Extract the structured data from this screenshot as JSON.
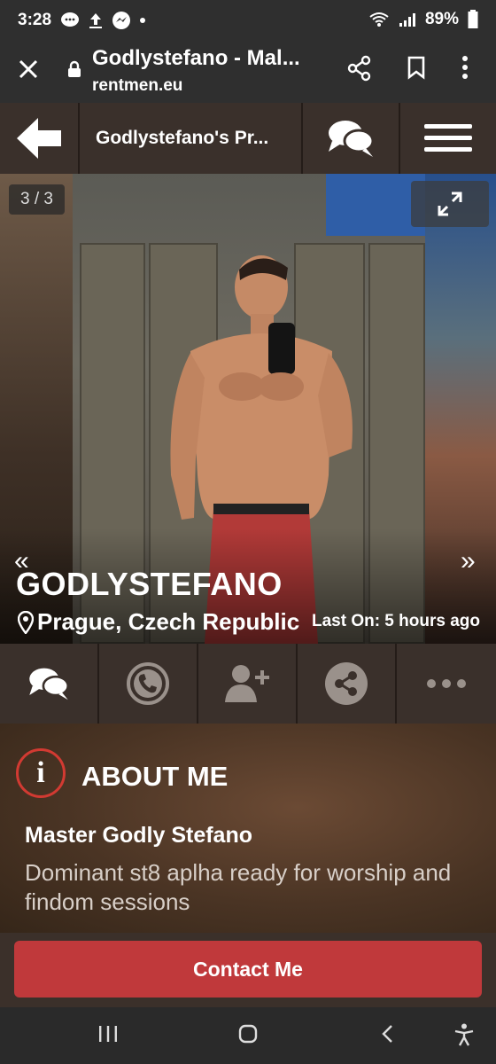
{
  "status_bar": {
    "time": "3:28",
    "battery": "89%",
    "icons": [
      "messages-icon",
      "upload-icon",
      "messenger-icon",
      "wifi-icon",
      "signal-icon",
      "battery-icon"
    ]
  },
  "browser": {
    "page_title": "Godlystefano - Mal...",
    "url": "rentmen.eu"
  },
  "site_header": {
    "title": "Godlystefano's Pr..."
  },
  "photo": {
    "counter": "3 / 3",
    "prev_label": "«",
    "next_label": "»"
  },
  "profile": {
    "name": "GODLYSTEFANO",
    "location": "Prague, Czech Republic",
    "last_on": "Last On: 5 hours ago"
  },
  "about": {
    "heading": "ABOUT ME",
    "info_glyph": "i",
    "subtitle": "Master Godly Stefano",
    "description": "Dominant st8 aplha ready for worship and findom sessions"
  },
  "contact": {
    "button_label": "Contact Me"
  },
  "colors": {
    "accent_red": "#c0393b",
    "header_brown": "#3a302b",
    "chrome_gray": "#2f2f2f"
  }
}
